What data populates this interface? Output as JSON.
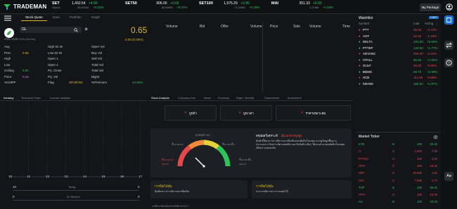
{
  "brand": "TRADEMAN",
  "indices": [
    {
      "name": "SET",
      "value": "1,432.54",
      "change": "+4.90",
      "sub": "Open1",
      "sub2": "",
      "dir": "up"
    },
    {
      "name": "SET50",
      "value": "906.00",
      "change": "+0.66",
      "sub": "89,669M",
      "sub2": "+0.07%",
      "dir": "up"
    },
    {
      "name": "SET100",
      "value": "1,975.29",
      "change": "+3.85",
      "sub": "71,225M",
      "sub2": "+0.20%",
      "dir": "up"
    },
    {
      "name": "MAI",
      "value": "351.33",
      "change": "+6.65",
      "sub": "1,176M",
      "sub2": "+1.93%",
      "dir": "up"
    }
  ],
  "index_extra": {
    "set_pct": "+0.34%",
    "set_vol": "80,000M"
  },
  "package_button": "My Package",
  "subtabs": [
    "Stock Quote",
    "Scan",
    "Portfolio",
    "Graph"
  ],
  "quote": {
    "symbol": "GL",
    "company": "บริษัท กรุ๊ปลีส จำกัด (มหาชน)",
    "price": "0.65",
    "change": "0.00 (0.00%)",
    "left": [
      [
        "Avg",
        ""
      ],
      [
        "Prev",
        "0.65"
      ],
      [
        "High",
        ""
      ],
      [
        "Low",
        ""
      ],
      [
        "Ceiling",
        "0.84"
      ],
      [
        "Floor",
        "0.46"
      ],
      [
        "%CMPF",
        ""
      ]
    ],
    "mid": [
      [
        "High 52 W",
        ""
      ],
      [
        "Low 52 W",
        ""
      ],
      [
        "Open 1",
        ""
      ],
      [
        "Open 2",
        ""
      ],
      [
        "Prj. Close",
        ""
      ],
      [
        "Prj. Vol",
        ""
      ],
      [
        "Flag",
        "SP,NP,NC"
      ]
    ],
    "right": [
      [
        "Open Vol",
        ""
      ],
      [
        "Buy Vol",
        ""
      ],
      [
        "Sell Vol",
        ""
      ],
      [
        "Total Vol",
        ""
      ],
      [
        "Total Val",
        ""
      ],
      [
        "Biglot",
        ""
      ],
      [
        "%Premium",
        "44.68%"
      ]
    ]
  },
  "depth_headers": [
    "Volume",
    "Bid",
    "Offer",
    "Volume",
    "Price",
    "Side",
    "Volume",
    "Time"
  ],
  "chart_tabs": [
    "Intraday",
    "Technical Chart",
    "Volume analysis"
  ],
  "chart_axis": [
    "10",
    "11",
    "12",
    "13",
    "14",
    "15",
    "16",
    "17"
  ],
  "chart_rows": [
    [
      "10",
      "Today",
      "0"
    ],
    [
      "0",
      "52 Week's",
      "0"
    ]
  ],
  "analysis_tabs": [
    "Stock Analysis",
    "Company Info",
    "News",
    "Financial",
    "Right / Benefit",
    "Shareholder",
    "Investment"
  ],
  "signals": [
    "ถูกตัว",
    "ถูกเวลา",
    "ราคาเหมาะสม"
  ],
  "gauge": {
    "title": "ผลลัพธ์ราคา",
    "left": "ขึ้นราคาลง",
    "right": "ขึ้นราคาขึ้น",
    "low": "ขึ้นราคาลงรุนแรง",
    "high": "ขึ้นราคาขึ้นรุนแรง"
  },
  "summary": {
    "title": "สรุปผลวิเคราะห์",
    "status": "มีแนวทางพุ่งสูง",
    "body": "หุ้นตัวนี้ต้องการการพิจารณาเพิ่มเติมก่อนตัดสินใจลงทุน ควรดูข้อมูลพื้นฐาน ประกอบการวิเคราะห์ทางเทคนิค และปัจจัยด้านอื่นๆ ให้ครบถ้วนก่อนตัดสินใจลงทุนเพื่อความปลอดภัย"
  },
  "cards": [
    {
      "title": "การปิดไม้หุ้น",
      "body": "หุ้นต้องการการพิจารณาเพิ่มเติม"
    },
    {
      "title": "การปิดไม้หุ้น",
      "body": "สามารถพิจารณาการลงทุนได้"
    }
  ],
  "footer_left": "กรณีทะเบียนหุ้นหลักทรัพย์ 04-02-1",
  "watchlist": {
    "title": "Watchlist",
    "badge": "1 SET",
    "headers": [
      "Symbol",
      "Last",
      "%Chg"
    ],
    "rows": [
      [
        "PTT",
        "36.50",
        "-0.72%",
        "dn"
      ],
      [
        "AOT",
        "62.50",
        "-1.18%",
        "dn"
      ],
      [
        "DELTA",
        "101.50",
        "+0.50%",
        "up"
      ],
      [
        "PTTEP",
        "144.00",
        "+1.77%",
        "up"
      ],
      [
        "ADVANC",
        "260.00",
        "-3.16%",
        "dn"
      ],
      [
        "CPALL",
        "66.50",
        "+1.92%",
        "up"
      ],
      [
        "GULF",
        "55.25",
        "-0.90%",
        "dn"
      ],
      [
        "BDMS",
        "29.75",
        "+2.59%",
        "up"
      ],
      [
        "SCB",
        "112.50",
        "-0.88%",
        "dn"
      ],
      [
        "KBANK",
        "155.50",
        "+1.97%",
        "up"
      ]
    ]
  },
  "ticker": {
    "title": "Market Ticker",
    "rows": [
      [
        "KTB",
        "B",
        "100",
        "20.40",
        "up"
      ],
      [
        "H",
        "S",
        "1,500",
        "7.00",
        "dn"
      ],
      [
        "PTTGC",
        "S",
        "100",
        "4.04",
        "dn"
      ],
      [
        "CPH",
        "S",
        "100",
        "19.20",
        "dn"
      ],
      [
        "NRF",
        "S",
        "40,000",
        "1.81",
        "dn"
      ],
      [
        "CPL",
        "S",
        "7,000",
        "1.77",
        "dn"
      ],
      [
        "TOP",
        "B",
        "100",
        "55.00",
        "up"
      ],
      [
        "CPH",
        "S",
        "100",
        "19.20",
        "dn"
      ],
      [
        "IVL",
        "B",
        "100",
        "23.40",
        "up"
      ]
    ]
  },
  "right_icons": [
    "package-icon",
    "arrows-icon",
    "help-icon",
    "text-size-icon"
  ],
  "text_size": "Aa",
  "colors": {
    "up": "#2fc25b",
    "down": "#e5474a",
    "accent": "#e5b92f"
  }
}
